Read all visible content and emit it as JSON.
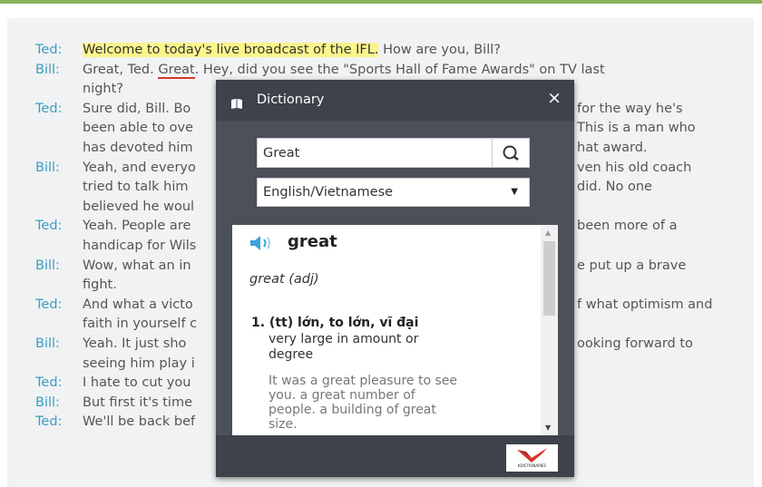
{
  "transcript": [
    {
      "speaker": "Ted:",
      "segments": [
        {
          "text": "Welcome to today's live broadcast of the IFL.",
          "style": "highlight"
        },
        {
          "text": " How are you, Bill?",
          "style": ""
        }
      ]
    },
    {
      "speaker": "Bill:",
      "segments": [
        {
          "text": "Great, Ted. ",
          "style": ""
        },
        {
          "text": "Great",
          "style": "underline"
        },
        {
          "text": ". Hey, did you see the \"Sports Hall of Fame Awards\" on TV last",
          "style": ""
        }
      ]
    },
    {
      "speaker": "",
      "segments": [
        {
          "text": "night?",
          "style": ""
        }
      ]
    },
    {
      "speaker": "Ted:",
      "segments": [
        {
          "text": "Sure did, Bill. Bo",
          "style": ""
        }
      ]
    },
    {
      "speaker": "",
      "segments": [
        {
          "text": "been able to ove",
          "style": ""
        }
      ]
    },
    {
      "speaker": "",
      "segments": [
        {
          "text": "has devoted him",
          "style": ""
        }
      ]
    },
    {
      "speaker": "Bill:",
      "segments": [
        {
          "text": "Yeah, and everyo",
          "style": ""
        }
      ]
    },
    {
      "speaker": "",
      "segments": [
        {
          "text": "tried to talk him",
          "style": ""
        }
      ]
    },
    {
      "speaker": "",
      "segments": [
        {
          "text": "believed he woul",
          "style": ""
        }
      ]
    },
    {
      "speaker": "Ted:",
      "segments": [
        {
          "text": "Yeah. People are",
          "style": ""
        }
      ]
    },
    {
      "speaker": "",
      "segments": [
        {
          "text": "handicap for Wils",
          "style": ""
        }
      ]
    },
    {
      "speaker": "Bill:",
      "segments": [
        {
          "text": "Wow, what an in",
          "style": ""
        }
      ]
    },
    {
      "speaker": "",
      "segments": [
        {
          "text": "fight.",
          "style": ""
        }
      ]
    },
    {
      "speaker": "Ted:",
      "segments": [
        {
          "text": "And what a victo",
          "style": ""
        }
      ]
    },
    {
      "speaker": "",
      "segments": [
        {
          "text": "faith in yourself c",
          "style": ""
        }
      ]
    },
    {
      "speaker": "Bill:",
      "segments": [
        {
          "text": "Yeah. It just sho",
          "style": ""
        }
      ]
    },
    {
      "speaker": "",
      "segments": [
        {
          "text": "seeing him play i",
          "style": ""
        }
      ]
    },
    {
      "speaker": "Ted:",
      "segments": [
        {
          "text": "I hate to cut you",
          "style": ""
        }
      ]
    },
    {
      "speaker": "Bill:",
      "segments": [
        {
          "text": "But first it's time",
          "style": ""
        }
      ]
    },
    {
      "speaker": "Ted:",
      "segments": [
        {
          "text": "We'll be back bef",
          "style": ""
        }
      ]
    }
  ],
  "right_fragments": [
    "for the way he's",
    "This is a man who",
    "hat award.",
    "ven his old coach",
    "did. No one",
    "been more of a",
    "e put up a brave",
    "f what optimism and",
    "ooking forward to"
  ],
  "dictionary": {
    "title": "Dictionary",
    "close_glyph": "×",
    "search_value": "Great",
    "language": "English/Vietnamese",
    "headword": "great",
    "pos": "great (adj)",
    "sense_head": "1. (tt) lớn, to lớn, vĩ đại",
    "sense_en": "very large in amount or degree",
    "example": "It was a great pleasure to see you. a great number of people. a building of great size.",
    "brand": "KDICTIONARIES"
  },
  "colors": {
    "accent_green": "#8ab35a",
    "speaker_blue": "#3a9ec4",
    "highlight": "#fbf58b",
    "popup_bg": "#4b505a"
  },
  "icons": [
    "book-icon",
    "close-icon",
    "search-icon",
    "speaker-icon",
    "chevron-down-icon"
  ]
}
